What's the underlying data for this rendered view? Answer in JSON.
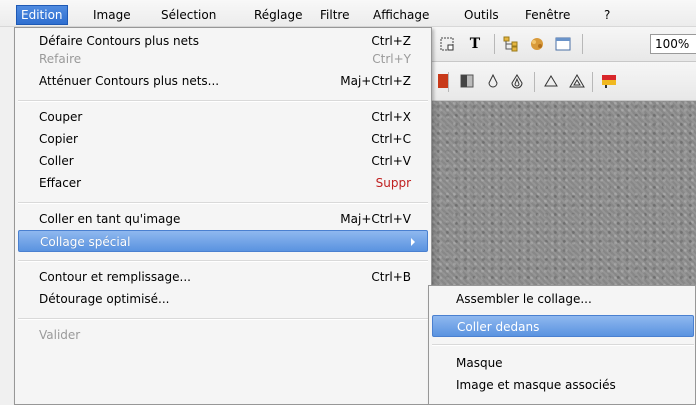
{
  "menubar": {
    "items": [
      {
        "label": "Edition",
        "active": true
      },
      {
        "label": "Image"
      },
      {
        "label": "Sélection"
      },
      {
        "label": "Réglage"
      },
      {
        "label": "Filtre"
      },
      {
        "label": "Affichage"
      },
      {
        "label": "Outils"
      },
      {
        "label": "Fenêtre"
      },
      {
        "label": "?"
      }
    ]
  },
  "toolbar": {
    "zoom_value": "100%"
  },
  "edit_menu": {
    "items": [
      {
        "label": "Défaire Contours plus nets",
        "shortcut": "Ctrl+Z"
      },
      {
        "label": "Refaire",
        "shortcut": "Ctrl+Y",
        "disabled": true
      },
      {
        "label": "Atténuer Contours plus nets...",
        "shortcut": "Maj+Ctrl+Z"
      },
      {
        "label": "Couper",
        "shortcut": "Ctrl+X"
      },
      {
        "label": "Copier",
        "shortcut": "Ctrl+C"
      },
      {
        "label": "Coller",
        "shortcut": "Ctrl+V"
      },
      {
        "label": "Effacer",
        "shortcut": "Suppr"
      },
      {
        "label": "Coller en tant qu'image",
        "shortcut": "Maj+Ctrl+V"
      },
      {
        "label": "Collage spécial",
        "shortcut": ""
      },
      {
        "label": "Contour et remplissage...",
        "shortcut": "Ctrl+B"
      },
      {
        "label": "Détourage optimisé...",
        "shortcut": ""
      },
      {
        "label": "Valider",
        "shortcut": "",
        "disabled": true
      }
    ]
  },
  "submenu": {
    "items": [
      {
        "label": "Assembler le collage..."
      },
      {
        "label": "Coller dedans"
      },
      {
        "label": "Masque"
      },
      {
        "label": "Image et masque associés"
      }
    ]
  }
}
